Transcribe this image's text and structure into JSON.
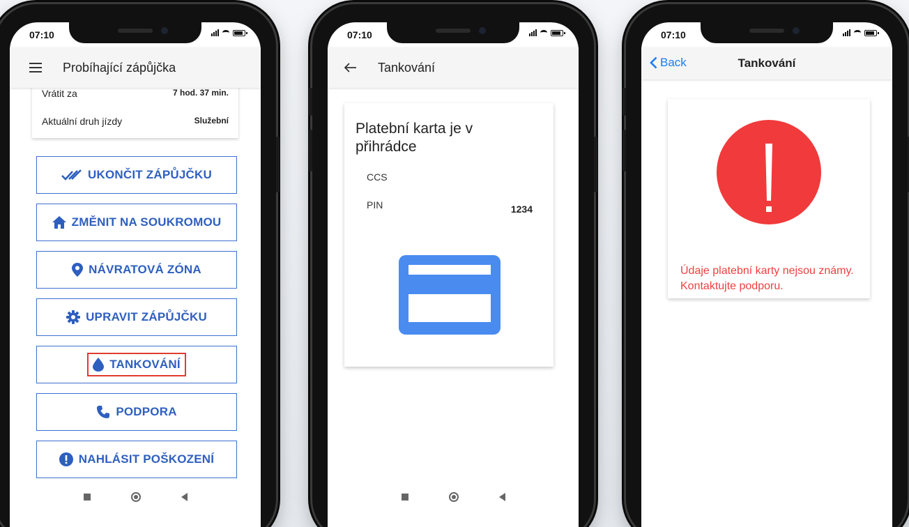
{
  "status_time": "07:10",
  "phone1": {
    "app_title": "Probíhající zápůjčka",
    "summary": [
      {
        "label": "Vrátit za",
        "value": "7 hod. 37 min."
      },
      {
        "label": "Aktuální druh jízdy",
        "value": "Služební"
      }
    ],
    "actions": [
      {
        "label": "UKONČIT ZÁPŮJČKU",
        "icon": "double-check-icon"
      },
      {
        "label": "ZMĚNIT NA SOUKROMOU",
        "icon": "home-icon"
      },
      {
        "label": "NÁVRATOVÁ ZÓNA",
        "icon": "location-pin-icon"
      },
      {
        "label": "UPRAVIT ZÁPŮJČKU",
        "icon": "gear-icon"
      },
      {
        "label": "TANKOVÁNÍ",
        "icon": "fuel-drop-icon",
        "highlighted": true
      },
      {
        "label": "PODPORA",
        "icon": "phone-icon"
      },
      {
        "label": "NAHLÁSIT POŠKOZENÍ",
        "icon": "alert-circle-icon"
      }
    ]
  },
  "phone2": {
    "app_title": "Tankování",
    "card_title": "Platební karta je v přihrádce",
    "rows": [
      {
        "label": "CCS",
        "value": ""
      },
      {
        "label": "PIN",
        "value": "1234"
      }
    ],
    "card_icon": "credit-card-icon"
  },
  "phone3": {
    "back_label": "Back",
    "app_title": "Tankování",
    "error_text": "Údaje platební karty nejsou známy. Kontaktujte podporu."
  },
  "colors": {
    "accent": "#2e5fbf",
    "card_blue": "#4a8bf0",
    "error_red": "#f13a3b",
    "highlight_border": "#e23b2e",
    "ios_blue": "#1a7cf5"
  }
}
